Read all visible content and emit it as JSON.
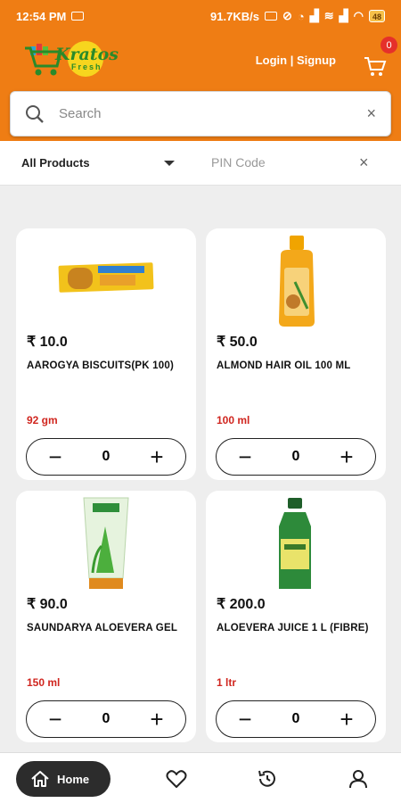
{
  "status_bar": {
    "time": "12:54 PM",
    "net_speed": "91.7KB/s",
    "battery": "48"
  },
  "header": {
    "brand_name": "Kratos",
    "brand_sub": "Fresh",
    "auth_label": "Login | Signup",
    "cart_count": "0"
  },
  "search": {
    "placeholder": "Search",
    "clear_icon": "×"
  },
  "filters": {
    "category": "All Products",
    "pin_placeholder": "PIN Code",
    "clear_icon": "×"
  },
  "products": [
    {
      "price": "₹ 10.0",
      "name": "AAROGYA BISCUITS(PK 100)",
      "qty_label": "92 gm",
      "count": "0"
    },
    {
      "price": "₹ 50.0",
      "name": "ALMOND HAIR OIL 100 ML",
      "qty_label": "100 ml",
      "count": "0"
    },
    {
      "price": "₹ 90.0",
      "name": "SAUNDARYA ALOEVERA GEL",
      "qty_label": "150 ml",
      "count": "0"
    },
    {
      "price": "₹ 200.0",
      "name": "ALOEVERA JUICE 1 L (FIBRE)",
      "qty_label": "1 ltr",
      "count": "0"
    }
  ],
  "stepper": {
    "minus": "−",
    "plus": "+"
  },
  "bottom_nav": {
    "home_label": "Home",
    "items": [
      "home-icon",
      "heart-icon",
      "history-icon",
      "user-icon"
    ]
  },
  "colors": {
    "brand_orange": "#ef7d14",
    "badge_red": "#e5302a",
    "qty_red": "#d0261f",
    "nav_dark": "#2c2c2c"
  }
}
